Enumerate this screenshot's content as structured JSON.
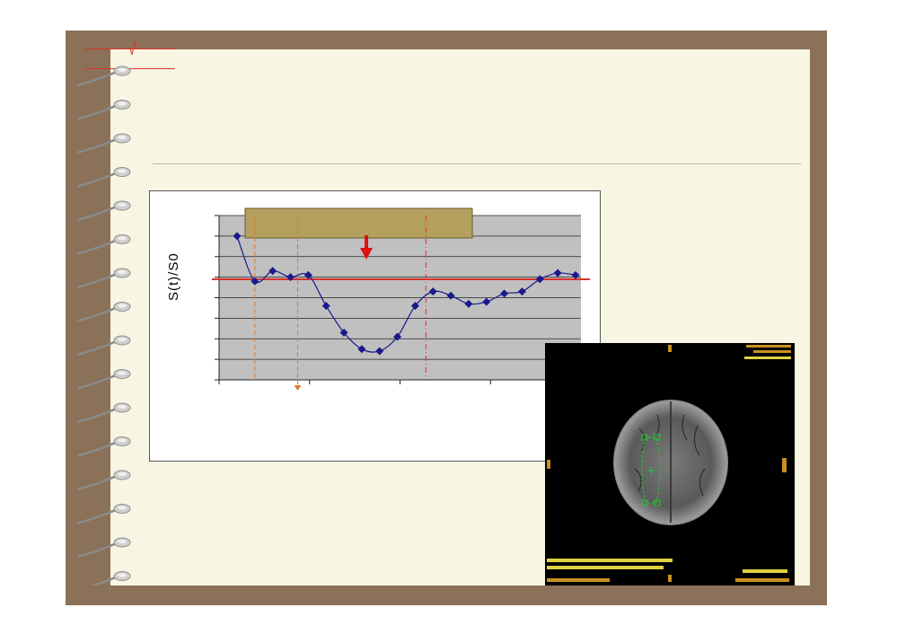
{
  "chart_data": {
    "type": "line",
    "ylabel": "S(t)/S0",
    "x": [
      1,
      2,
      3,
      4,
      5,
      6,
      7,
      8,
      9,
      10,
      11,
      12,
      13,
      14,
      15,
      16,
      17,
      18,
      19,
      20
    ],
    "values": [
      7.0,
      4.8,
      5.3,
      5.0,
      5.1,
      3.6,
      2.3,
      1.5,
      1.4,
      2.1,
      3.6,
      4.3,
      4.1,
      3.7,
      3.8,
      4.2,
      4.3,
      4.9,
      5.2,
      5.1
    ],
    "ylim": [
      0,
      8
    ],
    "grid": true,
    "colors": {
      "series": "#1a1a8c",
      "baseline": "#d8342c",
      "plot_bg": "#c0c0c0",
      "marker_line": "#e07a2b",
      "band": "#b3a05f"
    }
  },
  "image": {
    "subject": "brain-mri-axial-slice"
  }
}
